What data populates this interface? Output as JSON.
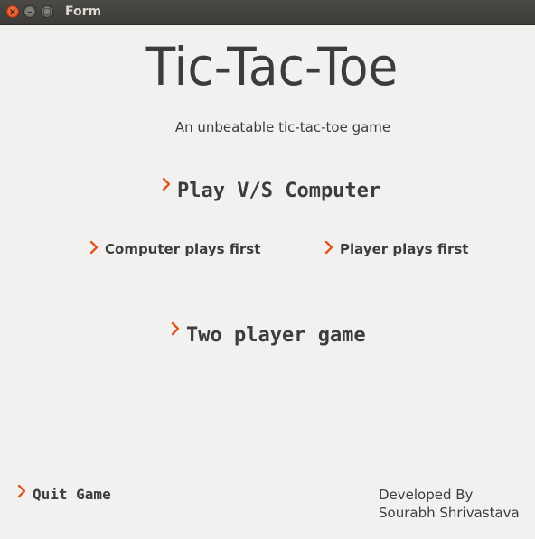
{
  "window": {
    "title": "Form",
    "close_glyph": "×",
    "minimize_glyph": "–",
    "maximize_glyph": "□"
  },
  "header": {
    "title": "Tic-Tac-Toe",
    "subtitle": "An unbeatable tic-tac-toe game"
  },
  "menu": {
    "play_vs_computer": "Play V/S Computer",
    "computer_plays_first": "Computer plays first",
    "player_plays_first": "Player plays first",
    "two_player_game": "Two player game",
    "quit_game": "Quit Game"
  },
  "footer": {
    "developed_by": "Developed By",
    "author": "Sourabh Shrivastava"
  },
  "colors": {
    "accent_chevron": "#e0531c",
    "text": "#3c3c3c",
    "background": "#f2f1f0",
    "titlebar": "#3c3b37"
  },
  "icons": {
    "command_link": "chevron-right-icon"
  }
}
